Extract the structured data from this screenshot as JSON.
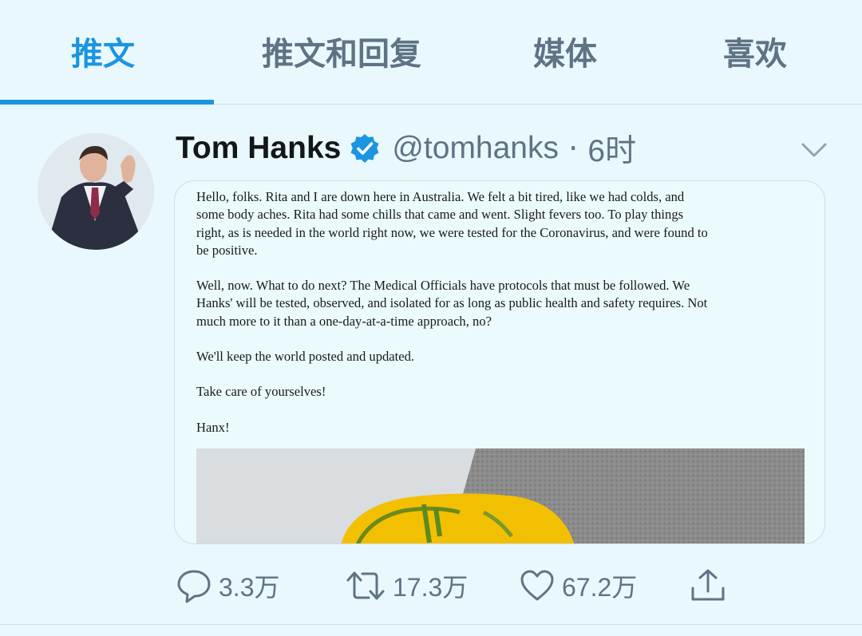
{
  "tabs": [
    {
      "label": "推文",
      "active": true
    },
    {
      "label": "推文和回复",
      "active": false
    },
    {
      "label": "媒体",
      "active": false
    },
    {
      "label": "喜欢",
      "active": false
    }
  ],
  "tweet": {
    "display_name": "Tom Hanks",
    "verified": true,
    "handle": "@tomhanks",
    "separator": "·",
    "time": "6时",
    "letter": [
      "Hello, folks. Rita and I are down here in Australia. We felt a bit tired, like we had colds, and\nsome body aches. Rita had some chills that came and went. Slight fevers too. To play things\nright, as is needed in the world right now, we were tested for the Coronavirus, and were found to\nbe positive.",
      "Well, now. What to do next? The Medical Officials have protocols that must be followed. We\nHanks' will be tested, observed, and isolated for as long as public health and safety requires.  Not\nmuch more to it than a one-day-at-a-time approach, no?",
      "We'll keep the world posted and updated.",
      "Take care of yourselves!",
      "Hanx!"
    ],
    "stats": {
      "replies": "3.3万",
      "retweets": "17.3万",
      "likes": "67.2万"
    }
  },
  "colors": {
    "accent": "#1b95e0",
    "muted": "#5f7385",
    "background": "#e9f8fc"
  },
  "icons": [
    "verified-badge-icon",
    "chevron-down-icon",
    "reply-icon",
    "retweet-icon",
    "like-icon",
    "share-icon"
  ]
}
